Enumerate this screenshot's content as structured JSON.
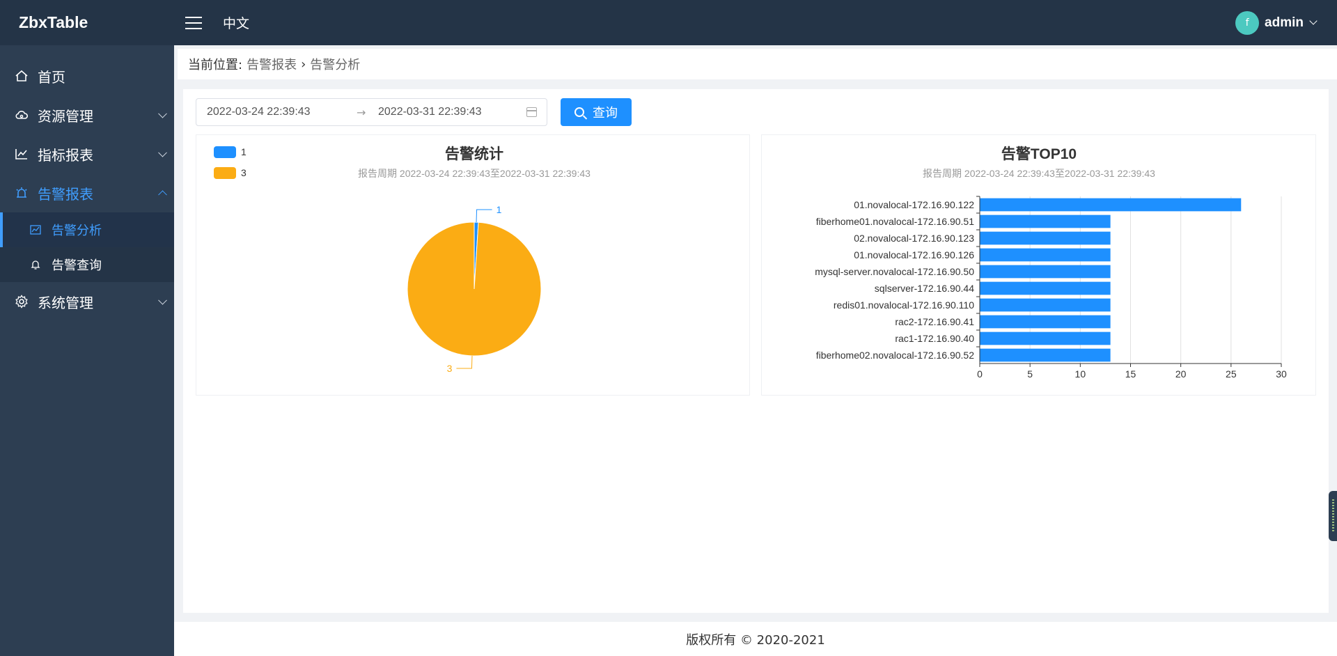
{
  "app": {
    "title": "ZbxTable"
  },
  "header": {
    "language": "中文",
    "username": "admin",
    "avatar_glyph": "f"
  },
  "sidebar": {
    "items": [
      {
        "label": "首页",
        "icon": "home-icon"
      },
      {
        "label": "资源管理",
        "icon": "cloud-icon"
      },
      {
        "label": "指标报表",
        "icon": "line-chart-icon"
      },
      {
        "label": "告警报表",
        "icon": "alarm-icon",
        "expanded": true
      },
      {
        "label": "系统管理",
        "icon": "gear-icon"
      }
    ],
    "sub_items": [
      {
        "label": "告警分析",
        "icon": "area-chart-icon",
        "active": true
      },
      {
        "label": "告警查询",
        "icon": "bell-icon"
      }
    ]
  },
  "breadcrumb": {
    "prefix": "当前位置:",
    "items": [
      "告警报表",
      "告警分析"
    ],
    "separator": "›"
  },
  "filter": {
    "start": "2022-03-24 22:39:43",
    "end": "2022-03-31 22:39:43",
    "arrow": "→",
    "query_label": "查询"
  },
  "chart_data": [
    {
      "type": "pie",
      "title": "告警统计",
      "subtitle": "报告周期 2022-03-24 22:39:43至2022-03-31 22:39:43",
      "legend_position": "top-left",
      "slices": [
        {
          "name": "1",
          "value": 1,
          "color": "#1e90ff"
        },
        {
          "name": "3",
          "value": 99,
          "color": "#fbac14"
        }
      ]
    },
    {
      "type": "bar",
      "orientation": "horizontal",
      "title": "告警TOP10",
      "subtitle": "报告周期 2022-03-24 22:39:43至2022-03-31 22:39:43",
      "color": "#1e90ff",
      "categories": [
        "01.novalocal-172.16.90.122",
        "fiberhome01.novalocal-172.16.90.51",
        "02.novalocal-172.16.90.123",
        "01.novalocal-172.16.90.126",
        "mysql-server.novalocal-172.16.90.50",
        "sqlserver-172.16.90.44",
        "redis01.novalocal-172.16.90.110",
        "rac2-172.16.90.41",
        "rac1-172.16.90.40",
        "fiberhome02.novalocal-172.16.90.52"
      ],
      "values": [
        26,
        13,
        13,
        13,
        13,
        13,
        13,
        13,
        13,
        13
      ],
      "xlim": [
        0,
        30
      ],
      "xticks": [
        0,
        5,
        10,
        15,
        20,
        25,
        30
      ],
      "grid": true
    }
  ],
  "footer": {
    "text": "版权所有 © 2020-2021"
  }
}
